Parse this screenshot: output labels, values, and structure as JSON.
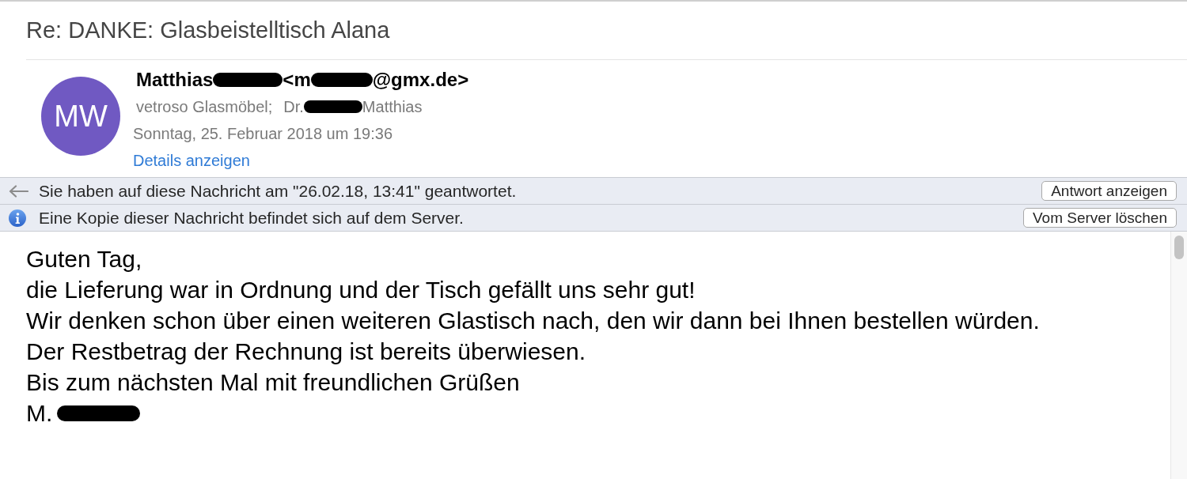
{
  "message": {
    "subject": "Re: DANKE: Glasbeistelltisch Alana"
  },
  "sender": {
    "avatar_initials": "MW",
    "from": [
      {
        "kind": "name",
        "text": "Matthias"
      },
      {
        "kind": "redaction"
      },
      {
        "kind": "address",
        "text": "<m"
      },
      {
        "kind": "redaction"
      },
      {
        "kind": "address",
        "text": "@gmx.de>"
      }
    ],
    "recipients": [
      {
        "kind": "recipient",
        "text": "vetroso Glasmöbel;"
      },
      {
        "kind": "recipient",
        "text": "Dr."
      },
      {
        "kind": "redaction"
      },
      {
        "kind": "recipient",
        "text": "Matthias"
      }
    ],
    "date": "Sonntag, 25. Februar 2018 um 19:36",
    "details_link": "Details anzeigen"
  },
  "notices": [
    {
      "kind": "replied",
      "text": "Sie haben auf diese Nachricht am \"26.02.18, 13:41\" geantwortet.",
      "button": "Antwort anzeigen"
    },
    {
      "kind": "info",
      "text": "Eine Kopie dieser Nachricht befindet sich auf dem Server.",
      "button": "Vom Server löschen"
    }
  ],
  "body": {
    "lines": [
      "Guten Tag,",
      "die Lieferung war in Ordnung und der Tisch gefällt uns sehr gut!",
      "Wir denken schon über einen weiteren Glastisch nach, den wir dann bei Ihnen bestellen würden.",
      "Der Restbetrag der Rechnung ist bereits überwiesen.",
      "Bis zum nächsten Mal mit freundlichen Grüßen"
    ],
    "signature": [
      {
        "kind": "text",
        "text": "M."
      },
      {
        "kind": "redaction"
      }
    ]
  }
}
